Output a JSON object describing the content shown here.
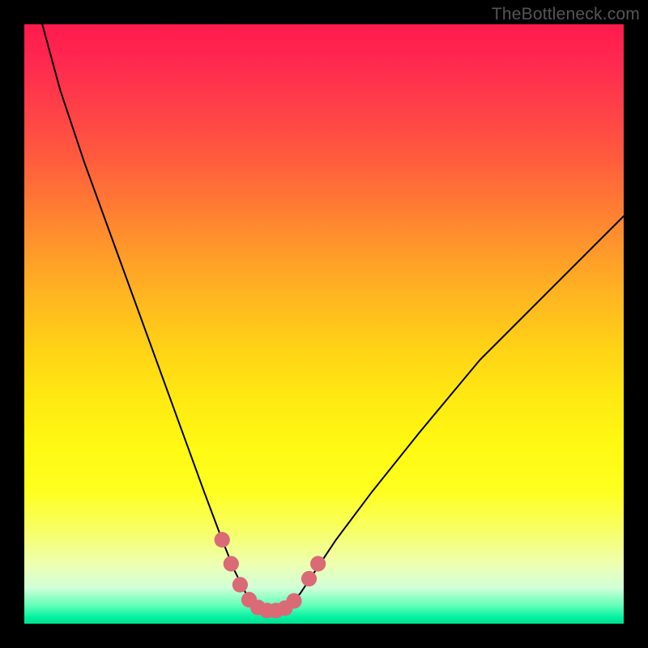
{
  "watermark": "TheBottleneck.com",
  "chart_data": {
    "type": "line",
    "title": "",
    "xlabel": "",
    "ylabel": "",
    "xlim": [
      0,
      100
    ],
    "ylim": [
      0,
      100
    ],
    "grid": false,
    "legend": false,
    "series": [
      {
        "name": "curve",
        "x": [
          3,
          6,
          10,
          14,
          18,
          22,
          26,
          30,
          33,
          35,
          37,
          38.5,
          40,
          42,
          44,
          46,
          48,
          52,
          58,
          66,
          76,
          88,
          100
        ],
        "y": [
          100,
          89,
          77,
          66,
          55,
          44,
          33,
          22,
          14,
          9,
          5,
          3,
          2.2,
          2.2,
          3,
          5,
          8,
          14,
          22,
          32,
          44,
          56,
          68
        ]
      }
    ],
    "markers": {
      "name": "highlight-dots",
      "color": "#d96a76",
      "radius_pct": 1.3,
      "points": [
        {
          "x": 33,
          "y": 14
        },
        {
          "x": 34.5,
          "y": 10
        },
        {
          "x": 36,
          "y": 6.5
        },
        {
          "x": 37.5,
          "y": 4
        },
        {
          "x": 39,
          "y": 2.7
        },
        {
          "x": 40.5,
          "y": 2.2
        },
        {
          "x": 42,
          "y": 2.2
        },
        {
          "x": 43.5,
          "y": 2.6
        },
        {
          "x": 45,
          "y": 3.8
        },
        {
          "x": 47.5,
          "y": 7.5
        },
        {
          "x": 49,
          "y": 10
        }
      ]
    }
  }
}
